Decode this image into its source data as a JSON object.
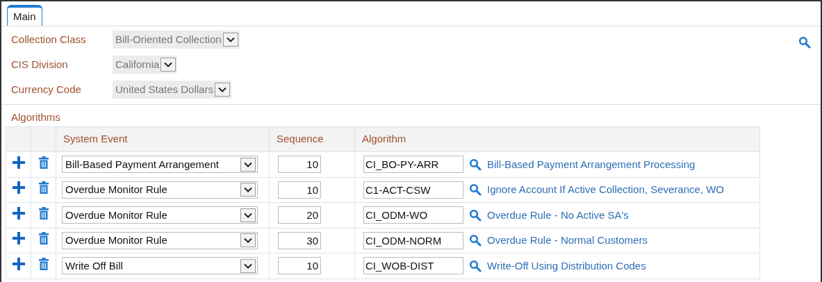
{
  "tabs": [
    {
      "label": "Main",
      "selected": true
    }
  ],
  "fields": [
    {
      "label": "Collection Class",
      "value": "Bill-Oriented Collection"
    },
    {
      "label": "CIS Division",
      "value": "California"
    },
    {
      "label": "Currency Code",
      "value": "United States Dollars"
    }
  ],
  "algorithms": {
    "title": "Algorithms",
    "columns": [
      "System Event",
      "Sequence",
      "Algorithm"
    ],
    "rows": [
      {
        "system_event": "Bill-Based Payment Arrangement",
        "sequence": "10",
        "algorithm": "CI_BO-PY-ARR",
        "description": "Bill-Based Payment Arrangement Processing"
      },
      {
        "system_event": "Overdue Monitor Rule",
        "sequence": "10",
        "algorithm": "C1-ACT-CSW",
        "description": "Ignore Account If Active Collection, Severance, WO"
      },
      {
        "system_event": "Overdue Monitor Rule",
        "sequence": "20",
        "algorithm": "CI_ODM-WO",
        "description": "Overdue Rule - No Active SA's"
      },
      {
        "system_event": "Overdue Monitor Rule",
        "sequence": "30",
        "algorithm": "CI_ODM-NORM",
        "description": "Overdue Rule - Normal Customers"
      },
      {
        "system_event": "Write Off Bill",
        "sequence": "10",
        "algorithm": "CI_WOB-DIST",
        "description": "Write-Off Using Distribution Codes"
      }
    ]
  }
}
